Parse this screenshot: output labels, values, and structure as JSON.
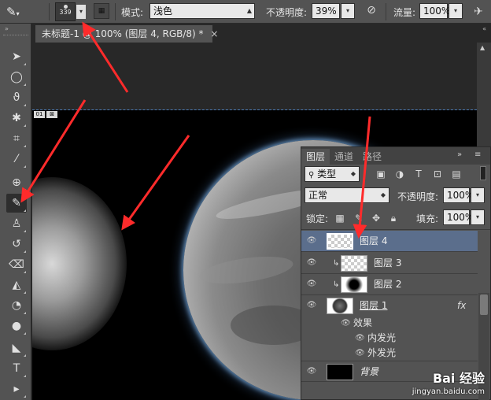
{
  "options_bar": {
    "brush_size": "339",
    "mode_label": "模式:",
    "mode_value": "浅色",
    "opacity_label": "不透明度:",
    "opacity_value": "39%",
    "flow_label": "流量:",
    "flow_value": "100%"
  },
  "document_tab": {
    "title": "未标题-1 @ 100% (图层 4, RGB/8) *",
    "close": "×"
  },
  "canvas_tags": [
    "01",
    "⊠"
  ],
  "layers_panel": {
    "tabs": [
      "图层",
      "通道",
      "路径"
    ],
    "filter_kind": "类型",
    "blend_mode": "正常",
    "opacity_label": "不透明度:",
    "opacity_value": "100%",
    "lock_label": "锁定:",
    "fill_label": "填充:",
    "fill_value": "100%",
    "layers": [
      {
        "name": "图层 4",
        "selected": true
      },
      {
        "name": "图层 3",
        "clipped": true
      },
      {
        "name": "图层 2",
        "clipped": true
      },
      {
        "name": "图层 1",
        "fx": "fx"
      }
    ],
    "effects_label": "效果",
    "effects": [
      "内发光",
      "外发光"
    ],
    "background_name": "背景"
  },
  "watermark": {
    "brand": "Bai 经验",
    "url": "jingyan.baidu.com"
  },
  "colors": {
    "annotation_arrow": "#ff2b2b",
    "selected_layer": "#5b6e8c",
    "panel_bg": "#535353"
  }
}
